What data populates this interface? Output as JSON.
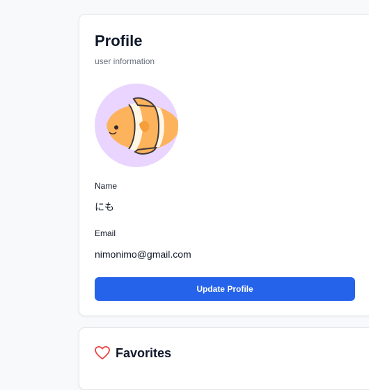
{
  "profile": {
    "title": "Profile",
    "subtitle": "user information",
    "avatar_icon": "clownfish-avatar",
    "name_label": "Name",
    "name_value": "にも",
    "email_label": "Email",
    "email_value": "nimonimo@gmail.com",
    "update_label": "Update Profile"
  },
  "favorites": {
    "title": "Favorites",
    "icon": "heart-icon"
  },
  "colors": {
    "accent": "#2563eb",
    "avatar_bg": "#e9d5ff",
    "heart": "#ef4444"
  }
}
